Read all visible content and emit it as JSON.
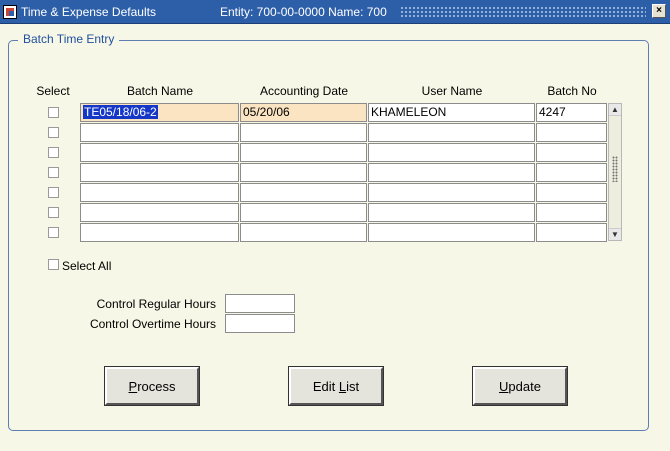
{
  "window": {
    "title": "Time & Expense Defaults",
    "entity_text": "Entity: 700-00-0000  Name: 700"
  },
  "group": {
    "legend": "Batch Time Entry"
  },
  "columns": {
    "select": "Select",
    "batch_name": "Batch Name",
    "accounting_date": "Accounting Date",
    "user_name": "User Name",
    "batch_no": "Batch No"
  },
  "rows": [
    {
      "batch_name": "TE05/18/06-2",
      "accounting_date": "05/20/06",
      "user_name": "KHAMELEON",
      "batch_no": "4247"
    },
    {
      "batch_name": "",
      "accounting_date": "",
      "user_name": "",
      "batch_no": ""
    },
    {
      "batch_name": "",
      "accounting_date": "",
      "user_name": "",
      "batch_no": ""
    },
    {
      "batch_name": "",
      "accounting_date": "",
      "user_name": "",
      "batch_no": ""
    },
    {
      "batch_name": "",
      "accounting_date": "",
      "user_name": "",
      "batch_no": ""
    },
    {
      "batch_name": "",
      "accounting_date": "",
      "user_name": "",
      "batch_no": ""
    },
    {
      "batch_name": "",
      "accounting_date": "",
      "user_name": "",
      "batch_no": ""
    }
  ],
  "select_all": {
    "label": "Select All"
  },
  "control": {
    "regular_label": "Control Regular Hours",
    "regular_value": "",
    "overtime_label": "Control Overtime Hours",
    "overtime_value": ""
  },
  "buttons": {
    "process_mnemonic": "P",
    "process_rest": "rocess",
    "edit_list_prefix": "Edit ",
    "edit_list_mnemonic": "L",
    "edit_list_rest": "ist",
    "update_mnemonic": "U",
    "update_rest": "pdate"
  },
  "colors": {
    "titlebar": "#2d5fa8",
    "current_record": "#fbe4c1",
    "selection": "#1437c8",
    "legend_text": "#1f4f9e"
  }
}
